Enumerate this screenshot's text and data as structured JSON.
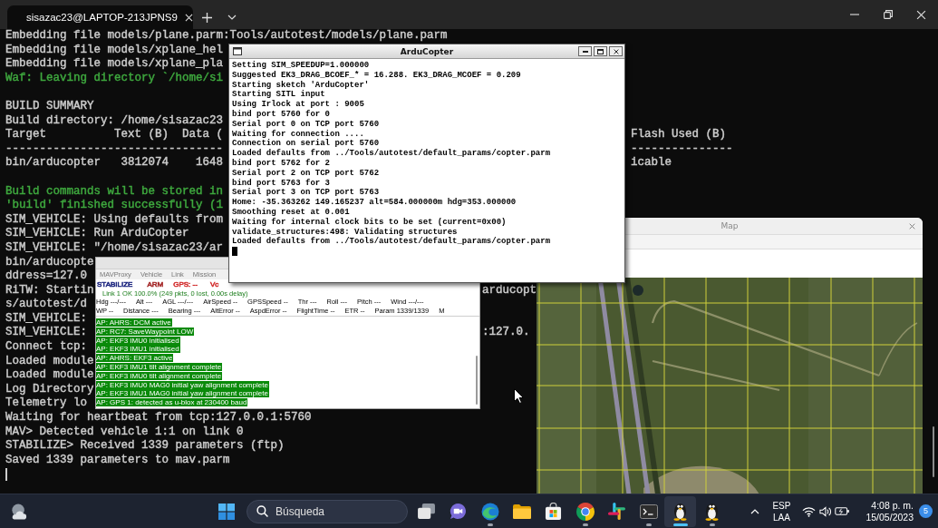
{
  "terminal": {
    "tab_title": "sisazac23@LAPTOP-213JPNS9",
    "blocks": [
      [
        {
          "text": "Embedding file models/plane.parm:Tools/autotest/models/plane.parm",
          "color": "#cccccc"
        },
        {
          "text": "Embedding file models/xplane_hel",
          "color": "#cccccc"
        },
        {
          "text": "Embedding file models/xplane_pla",
          "color": "#cccccc"
        },
        {
          "text": "Waf: Leaving directory `/home/si",
          "color": "#3ea83e"
        }
      ],
      [
        {
          "text": "BUILD SUMMARY",
          "color": "#cccccc"
        },
        {
          "text": "Build directory: /home/sisazac23",
          "color": "#cccccc"
        },
        {
          "text": "Target          Text (B)  Data (",
          "right": "Flash Used (B)",
          "color": "#cccccc"
        },
        {
          "text": "--------------------------------",
          "right": "---------------",
          "color": "#cccccc"
        },
        {
          "text": "bin/arducopter   3812074    1648",
          "right": "icable",
          "color": "#cccccc"
        }
      ],
      [
        {
          "text": "Build commands will be stored in",
          "color": "#3ea83e"
        },
        {
          "text": "'build' finished successfully (1",
          "color": "#3ea83e"
        },
        {
          "text": "SIM_VEHICLE: Using defaults from",
          "color": "#cccccc"
        },
        {
          "text": "SIM_VEHICLE: Run ArduCopter",
          "color": "#cccccc"
        },
        {
          "text": "SIM_VEHICLE: \"/home/sisazac23/ar",
          "color": "#cccccc"
        },
        {
          "text": "bin/arducopte",
          "color": "#cccccc"
        },
        {
          "text": "ddress=127.0",
          "color": "#cccccc"
        },
        {
          "text": "RiTW: Startin",
          "right": "arducopt",
          "color": "#cccccc"
        },
        {
          "text": "s/autotest/d",
          "color": "#cccccc"
        },
        {
          "text": "SIM_VEHICLE:",
          "color": "#cccccc"
        },
        {
          "text": "SIM_VEHICLE:",
          "right": ":127.0.",
          "color": "#cccccc"
        },
        {
          "text": "Connect tcp:",
          "color": "#cccccc"
        },
        {
          "text": "Loaded module",
          "color": "#cccccc"
        },
        {
          "text": "Loaded module",
          "color": "#cccccc"
        },
        {
          "text": "Log Directory",
          "color": "#cccccc"
        },
        {
          "text": "Telemetry lo",
          "color": "#cccccc"
        },
        {
          "text": "Waiting for heartbeat from tcp:127.0.0.1:5760",
          "color": "#cccccc"
        },
        {
          "text": "MAV> Detected vehicle 1:1 on link 0",
          "color": "#cccccc"
        },
        {
          "text": "STABILIZE> Received 1339 parameters (ftp)",
          "color": "#cccccc"
        },
        {
          "text": "Saved 1339 parameters to mav.parm",
          "color": "#cccccc"
        }
      ]
    ]
  },
  "arducopter": {
    "title": "ArduCopter",
    "lines": [
      "Setting SIM_SPEEDUP=1.000000",
      "Suggested EK3_DRAG_BCOEF_* = 16.288. EK3_DRAG_MCOEF = 0.209",
      "Starting sketch 'ArduCopter'",
      "Starting SITL input",
      "Using Irlock at port : 9005",
      "bind port 5760 for 0",
      "Serial port 0 on TCP port 5760",
      "Waiting for connection ....",
      "Connection on serial port 5760",
      "Loaded defaults from ../Tools/autotest/default_params/copter.parm",
      "bind port 5762 for 2",
      "Serial port 2 on TCP port 5762",
      "bind port 5763 for 3",
      "Serial port 3 on TCP port 5763",
      "Home: -35.363262 149.165237 alt=584.000000m hdg=353.000000",
      "Smoothing reset at 0.001",
      "Waiting for internal clock bits to be set (current=0x00)",
      "validate_structures:498: Validating structures",
      "Loaded defaults from ../Tools/autotest/default_params/copter.parm"
    ]
  },
  "mavproxy": {
    "menu": [
      "MAVProxy",
      "Vehicle",
      "Link",
      "Mission"
    ],
    "status": [
      {
        "text": "STABILIZE",
        "color": "#1a237e"
      },
      {
        "text": "ARM",
        "color": "#a52a2a"
      },
      {
        "text": "GPS: --",
        "color": "#d32f2f"
      },
      {
        "text": "Vc",
        "color": "#d32f2f"
      }
    ],
    "link": "Link 1 OK 100.0% (249 pkts, 0 lost, 0.00s delay)",
    "row_1": [
      "Hdg ---/---",
      "Alt ---",
      "AGL ---/---",
      "AirSpeed --",
      "GPSSpeed --",
      "Thr ---",
      "Roll ---",
      "Pitch ---",
      "Wind ---/---"
    ],
    "row_2": [
      "WP --",
      "Distance ---",
      "Bearing ---",
      "AltError --",
      "AspdError --",
      "FlightTime --",
      "ETR --",
      "Param 1339/1339",
      "M"
    ],
    "messages": [
      "AP: AHRS: DCM active",
      "AP: RC7: SaveWaypoint LOW",
      "AP: EKF3 IMU0 initialised",
      "AP: EKF3 IMU1 initialised",
      "AP: AHRS: EKF3 active",
      "AP: EKF3 IMU1 tilt alignment complete",
      "AP: EKF3 IMU0 tilt alignment complete",
      "AP: EKF3 IMU0 MAG0 initial yaw alignment complete",
      "AP: EKF3 IMU1 MAG0 initial yaw alignment complete",
      "AP: GPS 1: detected as u-blox at 230400 baud"
    ]
  },
  "map_window": {
    "title": "Map"
  },
  "taskbar": {
    "search": {
      "placeholder": "Búsqueda"
    },
    "apps": [
      {
        "kind": "taskview",
        "running": false,
        "selected": false
      },
      {
        "kind": "chat",
        "running": false,
        "selected": false
      },
      {
        "kind": "edge",
        "running": true,
        "selected": false
      },
      {
        "kind": "explorer",
        "running": false,
        "selected": false
      },
      {
        "kind": "store",
        "running": false,
        "selected": false
      },
      {
        "kind": "chrome",
        "running": true,
        "selected": false
      },
      {
        "kind": "slack",
        "running": false,
        "selected": false
      },
      {
        "kind": "terminal",
        "running": true,
        "selected": false
      },
      {
        "kind": "linux",
        "running": true,
        "selected": true
      },
      {
        "kind": "linux",
        "running": true,
        "selected": false
      }
    ],
    "language": [
      "ESP",
      "LAA"
    ],
    "time": "4:08 p. m.",
    "date": "15/05/2023",
    "notifications": "5"
  }
}
